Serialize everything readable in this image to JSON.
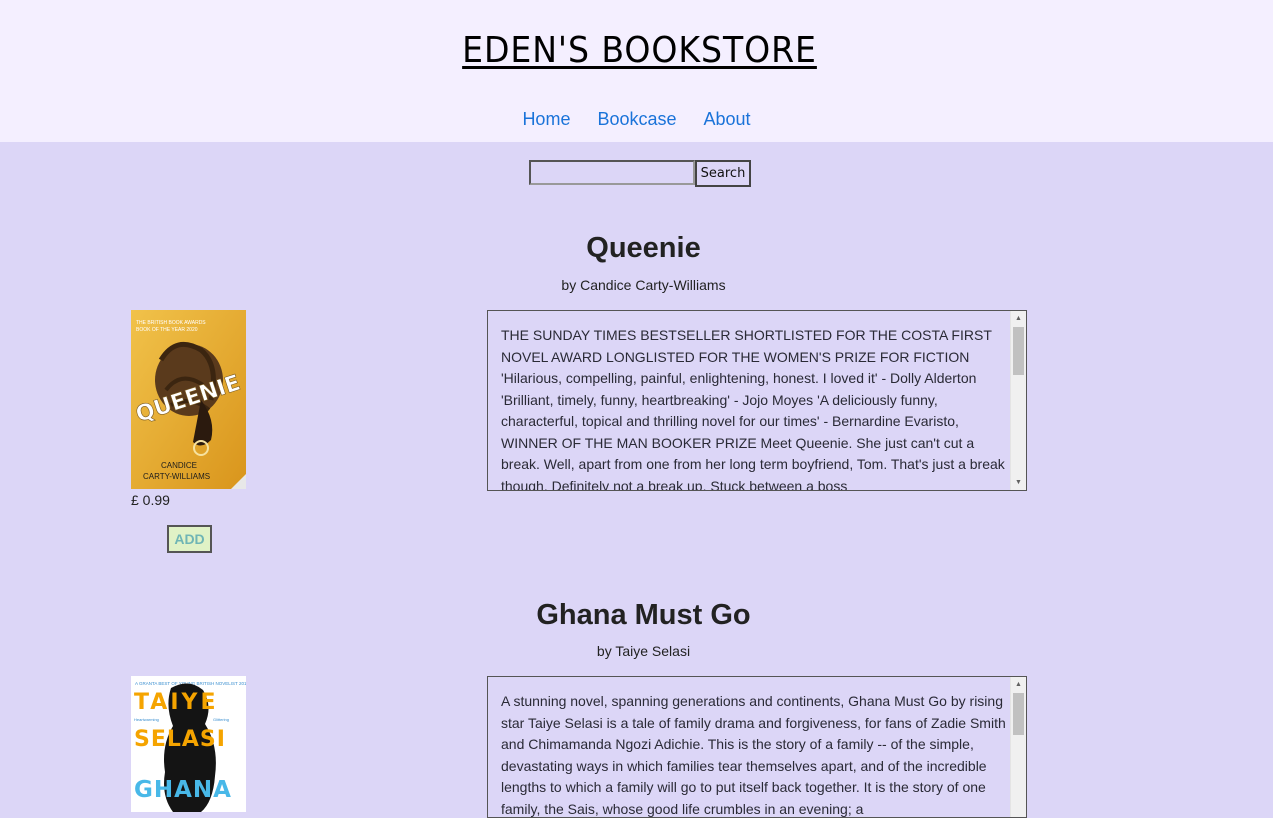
{
  "header": {
    "title": "EDEN'S BOOKSTORE",
    "nav": [
      "Home",
      "Bookcase",
      "About"
    ]
  },
  "search": {
    "value": "",
    "button_label": "Search"
  },
  "books": [
    {
      "title": "Queenie",
      "author": "by Candice Carty-Williams",
      "price": "£ 0.99",
      "add_label": "ADD",
      "cover_text": {
        "top": "THE BRITISH BOOK AWARDS BOOK OF THE YEAR 2020",
        "title": "QUEENIE",
        "author": "CANDICE CARTY-WILLIAMS"
      },
      "description": "THE SUNDAY TIMES BESTSELLER SHORTLISTED FOR THE COSTA FIRST NOVEL AWARD LONGLISTED FOR THE WOMEN'S PRIZE FOR FICTION 'Hilarious, compelling, painful, enlightening, honest. I loved it' - Dolly Alderton 'Brilliant, timely, funny, heartbreaking' - Jojo Moyes 'A deliciously funny, characterful, topical and thrilling novel for our times' - Bernardine Evaristo, WINNER OF THE MAN BOOKER PRIZE Meet Queenie. She just can't cut a break. Well, apart from one from her long term boyfriend, Tom. That's just a break though. Definitely not a break up. Stuck between a boss"
    },
    {
      "title": "Ghana Must Go",
      "author": "by Taiye Selasi",
      "price": "",
      "add_label": "",
      "cover_text": {
        "top": "A GRANTA BEST OF YOUNG BRITISH NOVELIST 2013",
        "name_line1": "TAIYE",
        "name_line2": "SELASI",
        "title": "GHANA"
      },
      "description": "A stunning novel, spanning generations and continents, Ghana Must Go by rising star Taiye Selasi is a tale of family drama and forgiveness, for fans of Zadie Smith and Chimamanda Ngozi Adichie. This is the story of a family -- of the simple, devastating ways in which families tear themselves apart, and of the incredible lengths to which a family will go to put itself back together. It is the story of one family, the Sais, whose good life crumbles in an evening; a"
    }
  ],
  "colors": {
    "page_bg": "#dcd6f7",
    "header_bg": "#f4efff",
    "link": "#1a73d9",
    "add_bg": "#e0f2c6",
    "add_text": "#6fb5b5"
  }
}
